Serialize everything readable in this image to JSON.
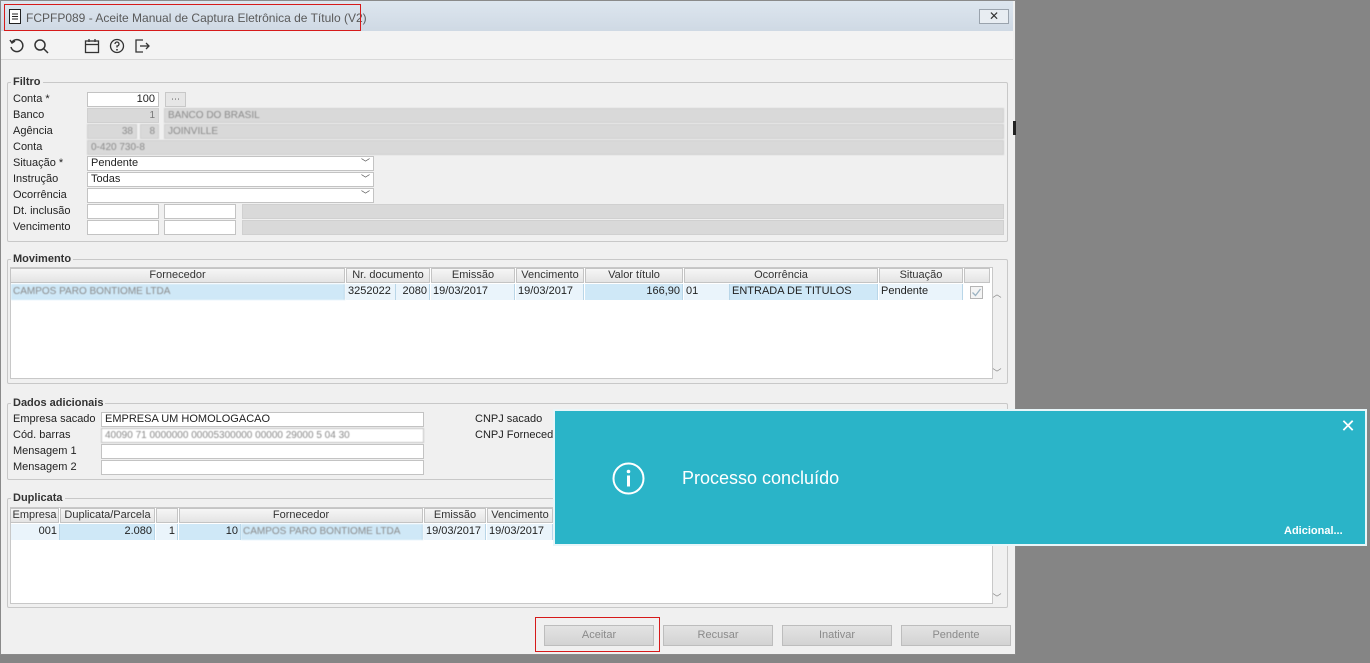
{
  "window": {
    "title": "FCPFP089 - Aceite Manual de Captura Eletrônica de Título (V2)",
    "close_label": "✕"
  },
  "toolbar": {
    "icons": [
      "refresh-icon",
      "search-icon",
      "calendar-icon",
      "help-icon",
      "exit-icon"
    ]
  },
  "filtro": {
    "legend": "Filtro",
    "conta_label": "Conta *",
    "conta_value": "100",
    "banco_label": "Banco",
    "banco_code": "1",
    "banco_name": "BANCO DO BRASIL",
    "agencia_label": "Agência",
    "agencia_code": "38",
    "agencia_digit": "8",
    "agencia_city": "JOINVILLE",
    "conta2_label": "Conta",
    "conta2_value": "0-420 730-8",
    "situacao_label": "Situação *",
    "situacao_value": "Pendente",
    "instrucao_label": "Instrução",
    "instrucao_value": "Todas",
    "ocorrencia_label": "Ocorrência",
    "ocorrencia_value": "",
    "dt_inclusao_label": "Dt. inclusão",
    "vencimento_label": "Vencimento"
  },
  "movimento": {
    "legend": "Movimento",
    "columns": [
      "Fornecedor",
      "Nr. documento",
      "Emissão",
      "Vencimento",
      "Valor título",
      "Ocorrência",
      "Situação"
    ],
    "rows": [
      {
        "fornecedor": "CAMPOS PARO BONTIOME LTDA",
        "nr_documento": "3252022",
        "nr_parcela": "2080",
        "emissao": "19/03/2017",
        "vencimento": "19/03/2017",
        "valor": "166,90",
        "ocorrencia_code": "01",
        "ocorrencia": "ENTRADA DE TITULOS",
        "situacao": "Pendente",
        "checked": true
      }
    ]
  },
  "dados": {
    "legend": "Dados adicionais",
    "empresa_label": "Empresa sacado",
    "empresa_value": "EMPRESA UM  HOMOLOGACAO",
    "cod_label": "Cód. barras",
    "cod_value": "40090 71 0000000 00005300000 00000 29000 5 04 30",
    "msg1_label": "Mensagem 1",
    "msg2_label": "Mensagem 2",
    "cnpj_sacado_label": "CNPJ sacado",
    "cnpj_fornecedor_label": "CNPJ Fornecedo"
  },
  "duplicata": {
    "legend": "Duplicata",
    "columns": [
      "Empresa",
      "Duplicata/Parcela",
      "",
      "Fornecedor",
      "Emissão",
      "Vencimento"
    ],
    "rows": [
      {
        "empresa": "001",
        "duplicata": "2.080",
        "parcela": "1",
        "fornecedor_code": "10",
        "fornecedor": "CAMPOS PARO BONTIOME LTDA",
        "emissao": "19/03/2017",
        "vencimento": "19/03/2017"
      }
    ]
  },
  "buttons": {
    "aceitar": "Aceitar",
    "recusar": "Recusar",
    "inativar": "Inativar",
    "pendente": "Pendente"
  },
  "toast": {
    "message": "Processo concluído",
    "more": "Adicional...",
    "close": "✕",
    "bg_color": "#2ab4c8"
  }
}
